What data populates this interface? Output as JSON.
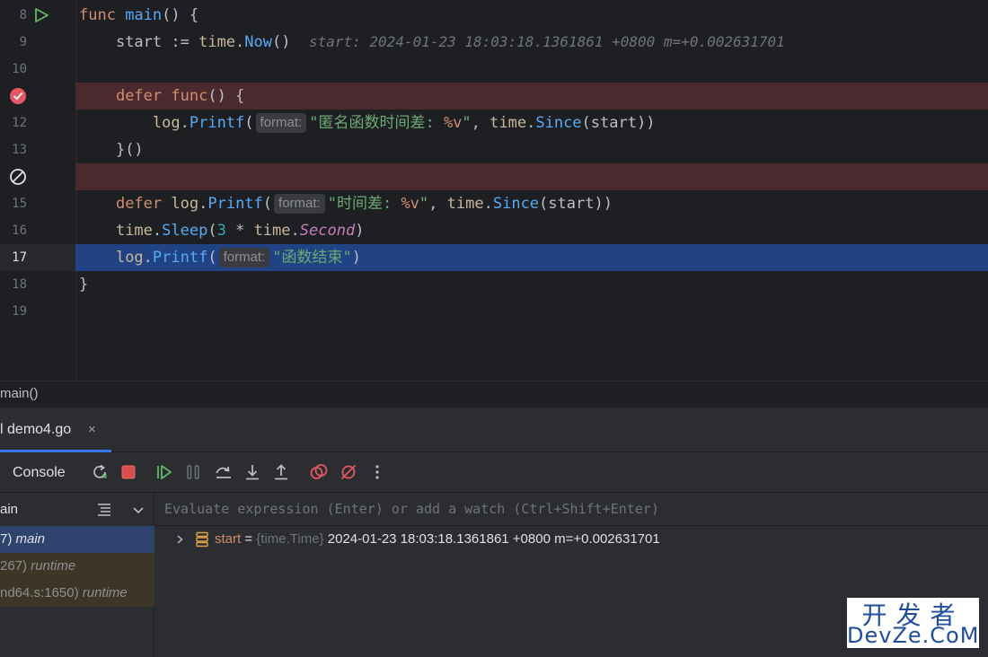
{
  "editor": {
    "line_numbers": [
      "8",
      "9",
      "10",
      "",
      "12",
      "13",
      "",
      "15",
      "16",
      "17",
      "18",
      "19"
    ],
    "lines": {
      "l8": {
        "kw": "func",
        "name": "main",
        "rest": "() {"
      },
      "l9": {
        "var": "start",
        "op": " := ",
        "pkg": "time",
        "dot": ".",
        "call": "Now",
        "paren": "()",
        "inline": "start: 2024-01-23 18:03:18.1361861 +0800 m=+0.002631701"
      },
      "l11": {
        "kw": "defer",
        "kw2": "func",
        "rest": "() {"
      },
      "l12": {
        "pkg": "log",
        "dot": ".",
        "call": "Printf",
        "open": "(",
        "hint": "format:",
        "str_a": "\"匿名函数时间差: ",
        "fmt": "%v",
        "str_b": "\"",
        "comma": ", ",
        "pkg2": "time",
        "dot2": ".",
        "call2": "Since",
        "args": "(start))"
      },
      "l13": {
        "text": "}()"
      },
      "l15": {
        "kw": "defer",
        "pkg": "log",
        "dot": ".",
        "call": "Printf",
        "open": "(",
        "hint": "format:",
        "str_a": "\"时间差: ",
        "fmt": "%v",
        "str_b": "\"",
        "comma": ", ",
        "pkg2": "time",
        "dot2": ".",
        "call2": "Since",
        "args": "(start))"
      },
      "l16": {
        "pkg": "time",
        "dot": ".",
        "call": "Sleep",
        "open": "(",
        "num": "3",
        "op": " * ",
        "pkg2": "time",
        "dot2": ".",
        "const": "Second",
        "close": ")"
      },
      "l17": {
        "pkg": "log",
        "dot": ".",
        "call": "Printf",
        "open": "(",
        "hint": "format:",
        "str": "\"函数结束\"",
        "close": ")"
      },
      "l18": {
        "text": "}"
      }
    }
  },
  "breadcrumb": "main()",
  "debug": {
    "tab": "demo4.go",
    "tab_prefix": "l",
    "tab_close": "×",
    "toolbar_console": "Console",
    "frames_header": "ain",
    "frames": [
      {
        "loc": "7) ",
        "func": "main"
      },
      {
        "loc": "267) ",
        "func": "runtime"
      },
      {
        "loc": "nd64.s:1650) ",
        "func": "runtime"
      }
    ],
    "eval_placeholder": "Evaluate expression (Enter) or add a watch (Ctrl+Shift+Enter)",
    "variable": {
      "name": "start",
      "eq": " = ",
      "type": "{time.Time}",
      "value": " 2024-01-23 18:03:18.1361861 +0800 m=+0.002631701"
    }
  },
  "watermark": {
    "top": "开发者",
    "bottom": "DevZe.CoM"
  },
  "colors": {
    "breakpoint_line": "#4a2a2e",
    "current_line": "#214283",
    "accent": "#3574f0",
    "breakpoint": "#e55765"
  }
}
